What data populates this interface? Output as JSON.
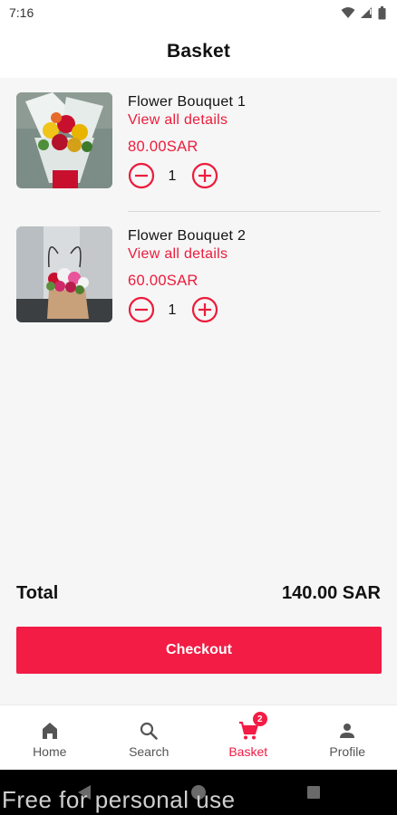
{
  "status_bar": {
    "time": "7:16"
  },
  "header": {
    "title": "Basket"
  },
  "basket": {
    "items": [
      {
        "name": "Flower Bouquet 1",
        "details_link": "View all details",
        "price": "80.00SAR",
        "quantity": "1",
        "image": "bouquet-photo"
      },
      {
        "name": "Flower Bouquet 2",
        "details_link": "View all details",
        "price": "60.00SAR",
        "quantity": "1",
        "image": "flower-bag-photo"
      }
    ]
  },
  "summary": {
    "total_label": "Total",
    "total_value": "140.00 SAR"
  },
  "checkout": {
    "label": "Checkout"
  },
  "bottom_nav": {
    "items": [
      {
        "label": "Home",
        "icon": "home-icon"
      },
      {
        "label": "Search",
        "icon": "search-icon"
      },
      {
        "label": "Basket",
        "icon": "cart-icon",
        "badge": "2",
        "active": true
      },
      {
        "label": "Profile",
        "icon": "person-icon"
      }
    ]
  },
  "watermark": "Free for personal use",
  "colors": {
    "accent": "#f21c44",
    "link": "#ec1c3c",
    "background": "#f6f6f6"
  }
}
